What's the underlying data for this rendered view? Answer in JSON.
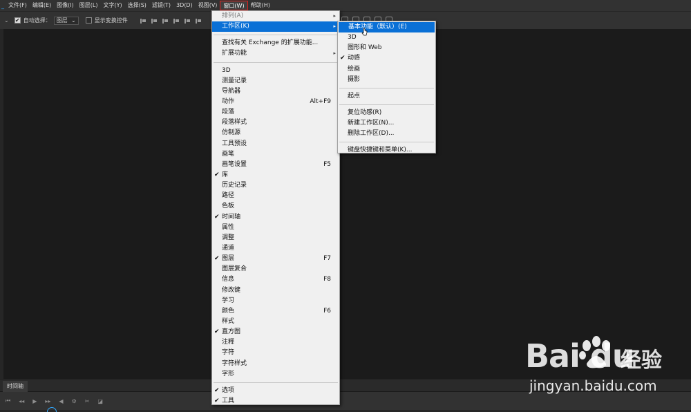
{
  "menubar": {
    "items": [
      {
        "label": "文件(F)",
        "active": false
      },
      {
        "label": "编辑(E)",
        "active": false
      },
      {
        "label": "图像(I)",
        "active": false
      },
      {
        "label": "图层(L)",
        "active": false
      },
      {
        "label": "文字(Y)",
        "active": false
      },
      {
        "label": "选择(S)",
        "active": false
      },
      {
        "label": "滤镜(T)",
        "active": false
      },
      {
        "label": "3D(D)",
        "active": false
      },
      {
        "label": "视图(V)",
        "active": false
      },
      {
        "label": "窗口(W)",
        "active": true
      },
      {
        "label": "帮助(H)",
        "active": false
      }
    ],
    "active_border_color": "#e0201d"
  },
  "optionsbar": {
    "auto_select_label": "自动选择：",
    "auto_select_value": "图层",
    "transform_label": "显示变换控件"
  },
  "window_menu": {
    "items": [
      {
        "label": "排列(A)",
        "arrow": true,
        "disabled": true
      },
      {
        "label": "工作区(K)",
        "arrow": true,
        "highlight": true
      },
      {
        "sep": true
      },
      {
        "label": "查找有关 Exchange 的扩展功能..."
      },
      {
        "label": "扩展功能",
        "arrow": true
      },
      {
        "sep": true
      },
      {
        "label": "3D"
      },
      {
        "label": "测量记录"
      },
      {
        "label": "导航器"
      },
      {
        "label": "动作",
        "shortcut": "Alt+F9"
      },
      {
        "label": "段落"
      },
      {
        "label": "段落样式"
      },
      {
        "label": "仿制源"
      },
      {
        "label": "工具预设"
      },
      {
        "label": "画笔"
      },
      {
        "label": "画笔设置",
        "shortcut": "F5"
      },
      {
        "label": "库",
        "checked": true
      },
      {
        "label": "历史记录"
      },
      {
        "label": "路径"
      },
      {
        "label": "色板"
      },
      {
        "label": "时间轴",
        "checked": true
      },
      {
        "label": "属性"
      },
      {
        "label": "调整"
      },
      {
        "label": "通道"
      },
      {
        "label": "图层",
        "checked": true,
        "shortcut": "F7"
      },
      {
        "label": "图层复合"
      },
      {
        "label": "信息",
        "shortcut": "F8"
      },
      {
        "label": "修改键"
      },
      {
        "label": "学习"
      },
      {
        "label": "颜色",
        "shortcut": "F6"
      },
      {
        "label": "样式"
      },
      {
        "label": "直方图",
        "checked": true
      },
      {
        "label": "注释"
      },
      {
        "label": "字符"
      },
      {
        "label": "字符样式"
      },
      {
        "label": "字形"
      },
      {
        "sep": true
      },
      {
        "label": "选项",
        "checked": true
      },
      {
        "label": "工具",
        "checked": true
      }
    ]
  },
  "workspace_submenu": {
    "items": [
      {
        "label": "基本功能（默认）(E)",
        "highlight": true
      },
      {
        "label": "3D"
      },
      {
        "label": "图形和 Web"
      },
      {
        "label": "动感",
        "checked": true
      },
      {
        "label": "绘画"
      },
      {
        "label": "摄影"
      },
      {
        "sep": true
      },
      {
        "label": "起点"
      },
      {
        "sep": true
      },
      {
        "label": "复位动感(R)"
      },
      {
        "label": "新建工作区(N)..."
      },
      {
        "label": "删除工作区(D)..."
      },
      {
        "sep": true
      },
      {
        "label": "键盘快捷键和菜单(K)..."
      }
    ]
  },
  "timeline": {
    "tab_label": "时间轴"
  },
  "watermark": {
    "logo": "Bai du",
    "cn_text": "经验",
    "url": "jingyan.baidu.com"
  },
  "colors": {
    "highlight": "#0a70d6",
    "menu_bg": "#f0f0f0",
    "app_bg": "#1b1b1b",
    "toolbar_bg": "#323232",
    "playhead": "#31a8ff"
  },
  "icons": {
    "check": "✔",
    "submenu_arrow": "▸",
    "checkbox_checked": "✔"
  }
}
